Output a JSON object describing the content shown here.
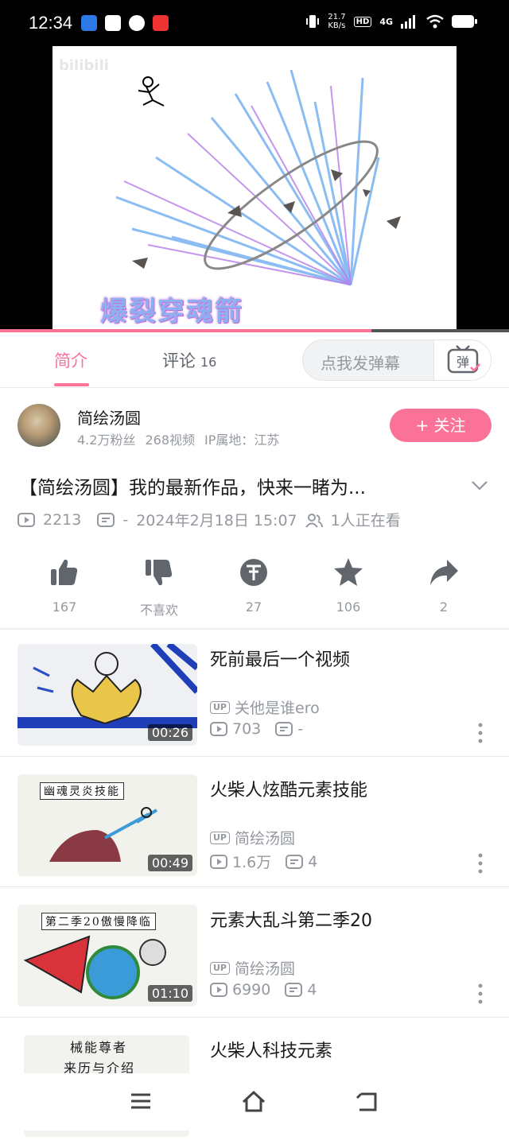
{
  "status": {
    "time": "12:34",
    "net_speed_value": "21.7",
    "net_speed_unit": "KB/s",
    "hd": "HD",
    "signal": "4G"
  },
  "player": {
    "watermark": "bilibili",
    "art_title": "爆裂穿魂箭",
    "progress_fraction": 0.73
  },
  "tabs": [
    {
      "label": "简介",
      "active": true
    },
    {
      "label": "评论",
      "count": "16"
    }
  ],
  "danmaku": {
    "placeholder": "点我发弹幕",
    "icon_label": "弹"
  },
  "uploader": {
    "name": "简绘汤圆",
    "fans": "4.2万粉丝",
    "videos": "268视频",
    "ip": "IP属地：江苏",
    "follow_label": "+ 关注"
  },
  "video": {
    "title": "【简绘汤圆】我的最新作品，快来一睹为...",
    "views": "2213",
    "danmaku_count": "-",
    "date": "2024年2月18日 15:07",
    "watching": "1人正在看"
  },
  "actions": [
    {
      "icon": "like-icon",
      "label": "167"
    },
    {
      "icon": "dislike-icon",
      "label": "不喜欢"
    },
    {
      "icon": "coin-icon",
      "label": "27"
    },
    {
      "icon": "star-icon",
      "label": "106"
    },
    {
      "icon": "share-icon",
      "label": "2"
    }
  ],
  "recommendations": [
    {
      "title": "死前最后一个视频",
      "author": "关他是谁ero",
      "views": "703",
      "danmaku": "-",
      "duration": "00:26"
    },
    {
      "title": "火柴人炫酷元素技能",
      "author": "简绘汤圆",
      "views": "1.6万",
      "danmaku": "4",
      "duration": "00:49",
      "thumb_text": "幽魂灵炎技能"
    },
    {
      "title": "元素大乱斗第二季20",
      "author": "简绘汤圆",
      "views": "6990",
      "danmaku": "4",
      "duration": "01:10",
      "thumb_text": "第二季20傲慢降临"
    },
    {
      "title": "火柴人科技元素",
      "thumb_text_1": "械能尊者",
      "thumb_text_2": "来历与介绍"
    }
  ],
  "colors": {
    "accent": "#fb7299",
    "muted": "#9499a0",
    "text": "#18191c"
  },
  "up_badge": "UP"
}
